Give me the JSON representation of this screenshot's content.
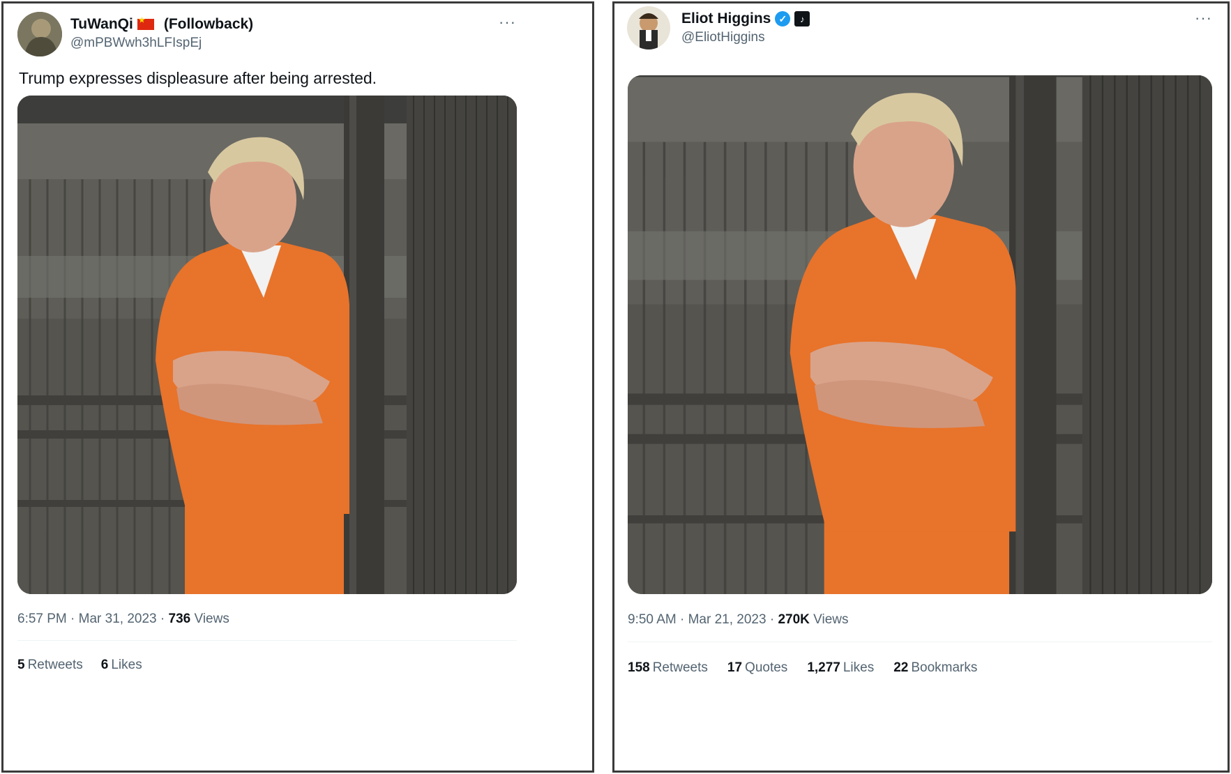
{
  "tweets": [
    {
      "display_name": "TuWanQi",
      "followback": "(Followback)",
      "handle": "@mPBWwh3hLFIspEj",
      "more": "···",
      "text": "Trump expresses displeasure after being arrested.",
      "time": "6:57 PM",
      "date": "Mar 31, 2023",
      "views_count": "736",
      "views_label": "Views",
      "stats": [
        {
          "count": "5",
          "label": "Retweets"
        },
        {
          "count": "6",
          "label": "Likes"
        }
      ]
    },
    {
      "display_name": "Eliot Higgins",
      "handle": "@EliotHiggins",
      "more": "···",
      "verified_glyph": "✓",
      "badge_glyph": "♪",
      "time": "9:50 AM",
      "date": "Mar 21, 2023",
      "views_count": "270K",
      "views_label": "Views",
      "stats": [
        {
          "count": "158",
          "label": "Retweets"
        },
        {
          "count": "17",
          "label": "Quotes"
        },
        {
          "count": "1,277",
          "label": "Likes"
        },
        {
          "count": "22",
          "label": "Bookmarks"
        }
      ]
    }
  ],
  "separator": "·",
  "colors": {
    "text": "#0f1419",
    "secondary": "#536471",
    "verified": "#1d9bf0",
    "jumpsuit": "#e8732a",
    "flag": "#de2910"
  },
  "icons": [
    "china-flag-icon",
    "verified-badge-icon",
    "affiliate-badge-icon",
    "more-options-icon"
  ]
}
